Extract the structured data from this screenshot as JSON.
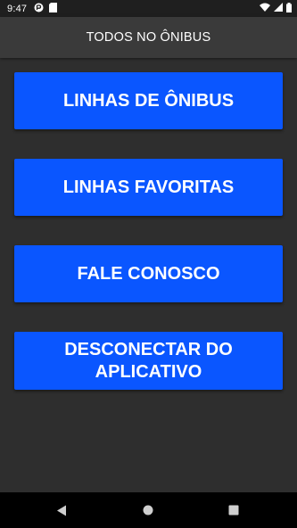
{
  "status_bar": {
    "time": "9:47",
    "icons": [
      "notification-icon",
      "sd-card-icon",
      "wifi-icon",
      "signal-icon",
      "battery-icon"
    ]
  },
  "app_bar": {
    "title": "TODOS NO ÔNIBUS"
  },
  "menu": {
    "buttons": [
      {
        "label": "LINHAS DE ÔNIBUS"
      },
      {
        "label": "LINHAS FAVORITAS"
      },
      {
        "label": "FALE CONOSCO"
      },
      {
        "label": "DESCONECTAR DO\nAPLICATIVO"
      }
    ]
  },
  "nav_bar": {
    "icons": [
      "back-icon",
      "home-icon",
      "recents-icon"
    ]
  },
  "colors": {
    "button": "#0a56ff",
    "background": "#2e2e2e",
    "app_bar": "#3a3a3a"
  }
}
